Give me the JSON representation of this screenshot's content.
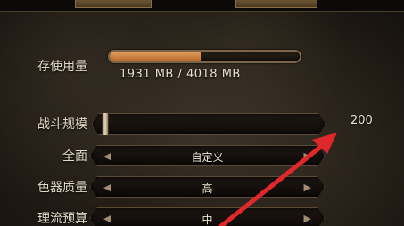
{
  "labels": {
    "memory": "存使用量",
    "battle_size": "战斗规模",
    "fullscreen": "全面",
    "weapon_quality": "色器质量",
    "physics_budget": "理流预算"
  },
  "memory": {
    "text": "1931 MB / 4018 MB",
    "used_fraction": 0.48
  },
  "battle_size": {
    "value": "200"
  },
  "fullscreen": {
    "value": "自定义"
  },
  "weapon_quality": {
    "value": "高"
  },
  "physics_budget": {
    "value": "中"
  },
  "annotation": {
    "color": "#e0282a"
  }
}
